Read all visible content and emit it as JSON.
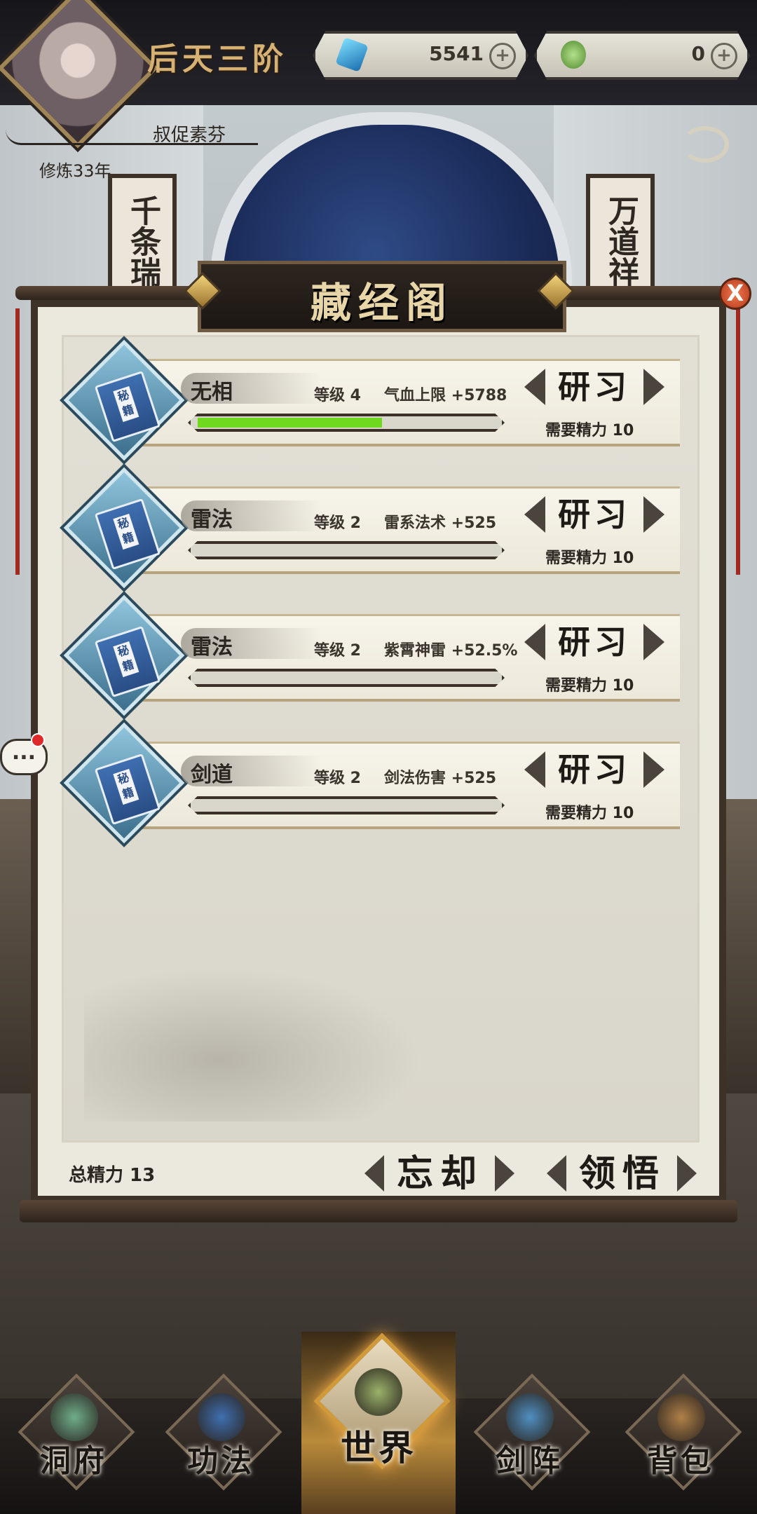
{
  "header": {
    "realm": "后天三阶",
    "nickname": "叔促素芬",
    "cultivation_years": "修炼33年",
    "resources": [
      {
        "icon": "spirit-stone-icon",
        "value": "5541",
        "plus": "+"
      },
      {
        "icon": "jade-icon",
        "value": "0",
        "plus": "+"
      }
    ]
  },
  "background": {
    "banner_left": "千条瑞",
    "banner_right": "万道祥"
  },
  "panel": {
    "title": "藏经阁",
    "close": "X",
    "skills": [
      {
        "name": "无相",
        "level": "等级 4",
        "effect": "气血上限 +5788",
        "progress": 0.62,
        "button": "研习",
        "cost": "需要精力 10",
        "book_label": "秘籍"
      },
      {
        "name": "雷法",
        "level": "等级 2",
        "effect": "雷系法术 +525",
        "progress": 0,
        "button": "研习",
        "cost": "需要精力 10",
        "book_label": "秘籍"
      },
      {
        "name": "雷法",
        "level": "等级 2",
        "effect": "紫霄神雷 +52.5%",
        "progress": 0,
        "button": "研习",
        "cost": "需要精力 10",
        "book_label": "秘籍"
      },
      {
        "name": "剑道",
        "level": "等级 2",
        "effect": "剑法伤害 +525",
        "progress": 0,
        "button": "研习",
        "cost": "需要精力 10",
        "book_label": "秘籍"
      }
    ],
    "total_energy": "总精力 13",
    "forget_button": "忘却",
    "comprehend_button": "领悟"
  },
  "chat": {
    "label": "..."
  },
  "nav": {
    "items": [
      {
        "label": "洞府",
        "icon": "cave-dwelling-icon",
        "color": "#6fae8a"
      },
      {
        "label": "功法",
        "icon": "manual-book-icon",
        "color": "#3f6fb0"
      },
      {
        "label": "世界",
        "icon": "world-map-icon",
        "color": "#9ab26a"
      },
      {
        "label": "剑阵",
        "icon": "sword-array-icon",
        "color": "#4f8fc0"
      },
      {
        "label": "背包",
        "icon": "bag-icon",
        "color": "#b08048"
      }
    ]
  },
  "colors": {
    "progress_fill": "#6fd91f",
    "title_gold": "#e8d6a8",
    "accent_gold": "#d6b173"
  }
}
